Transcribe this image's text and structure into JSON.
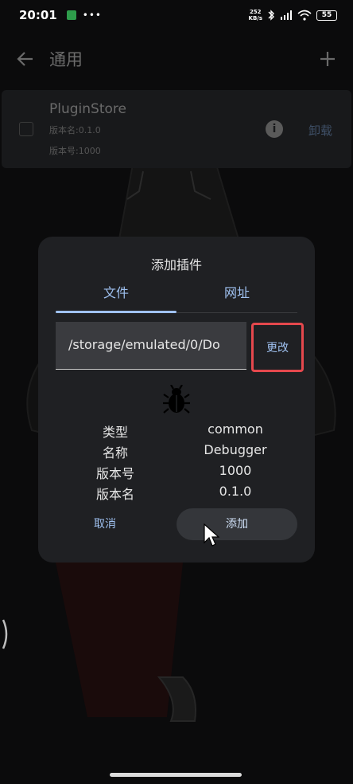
{
  "status_bar": {
    "time": "20:01",
    "network_speed_top": "252",
    "network_speed_bottom": "KB/s",
    "battery": "55"
  },
  "app_bar": {
    "title": "通用"
  },
  "plugin_card": {
    "name": "PluginStore",
    "version_name": "版本名:0.1.0",
    "version_code": "版本号:1000",
    "uninstall_label": "卸载"
  },
  "dialog": {
    "title": "添加插件",
    "tabs": [
      {
        "label": "文件",
        "selected": true
      },
      {
        "label": "网址",
        "selected": false
      }
    ],
    "path_value": "/storage/emulated/0/Do",
    "change_label": "更改",
    "info_rows": [
      {
        "label": "类型",
        "value": "common"
      },
      {
        "label": "名称",
        "value": "Debugger"
      },
      {
        "label": "版本号",
        "value": "1000"
      },
      {
        "label": "版本名",
        "value": "0.1.0"
      }
    ],
    "cancel_label": "取消",
    "add_label": "添加"
  },
  "colors": {
    "accent": "#9fc1f0",
    "highlight_border": "#e5484d",
    "dialog_bg": "#1f2023"
  },
  "icons": [
    "back-arrow-icon",
    "plus-icon",
    "info-icon",
    "bug-icon",
    "mouse-cursor-icon"
  ]
}
